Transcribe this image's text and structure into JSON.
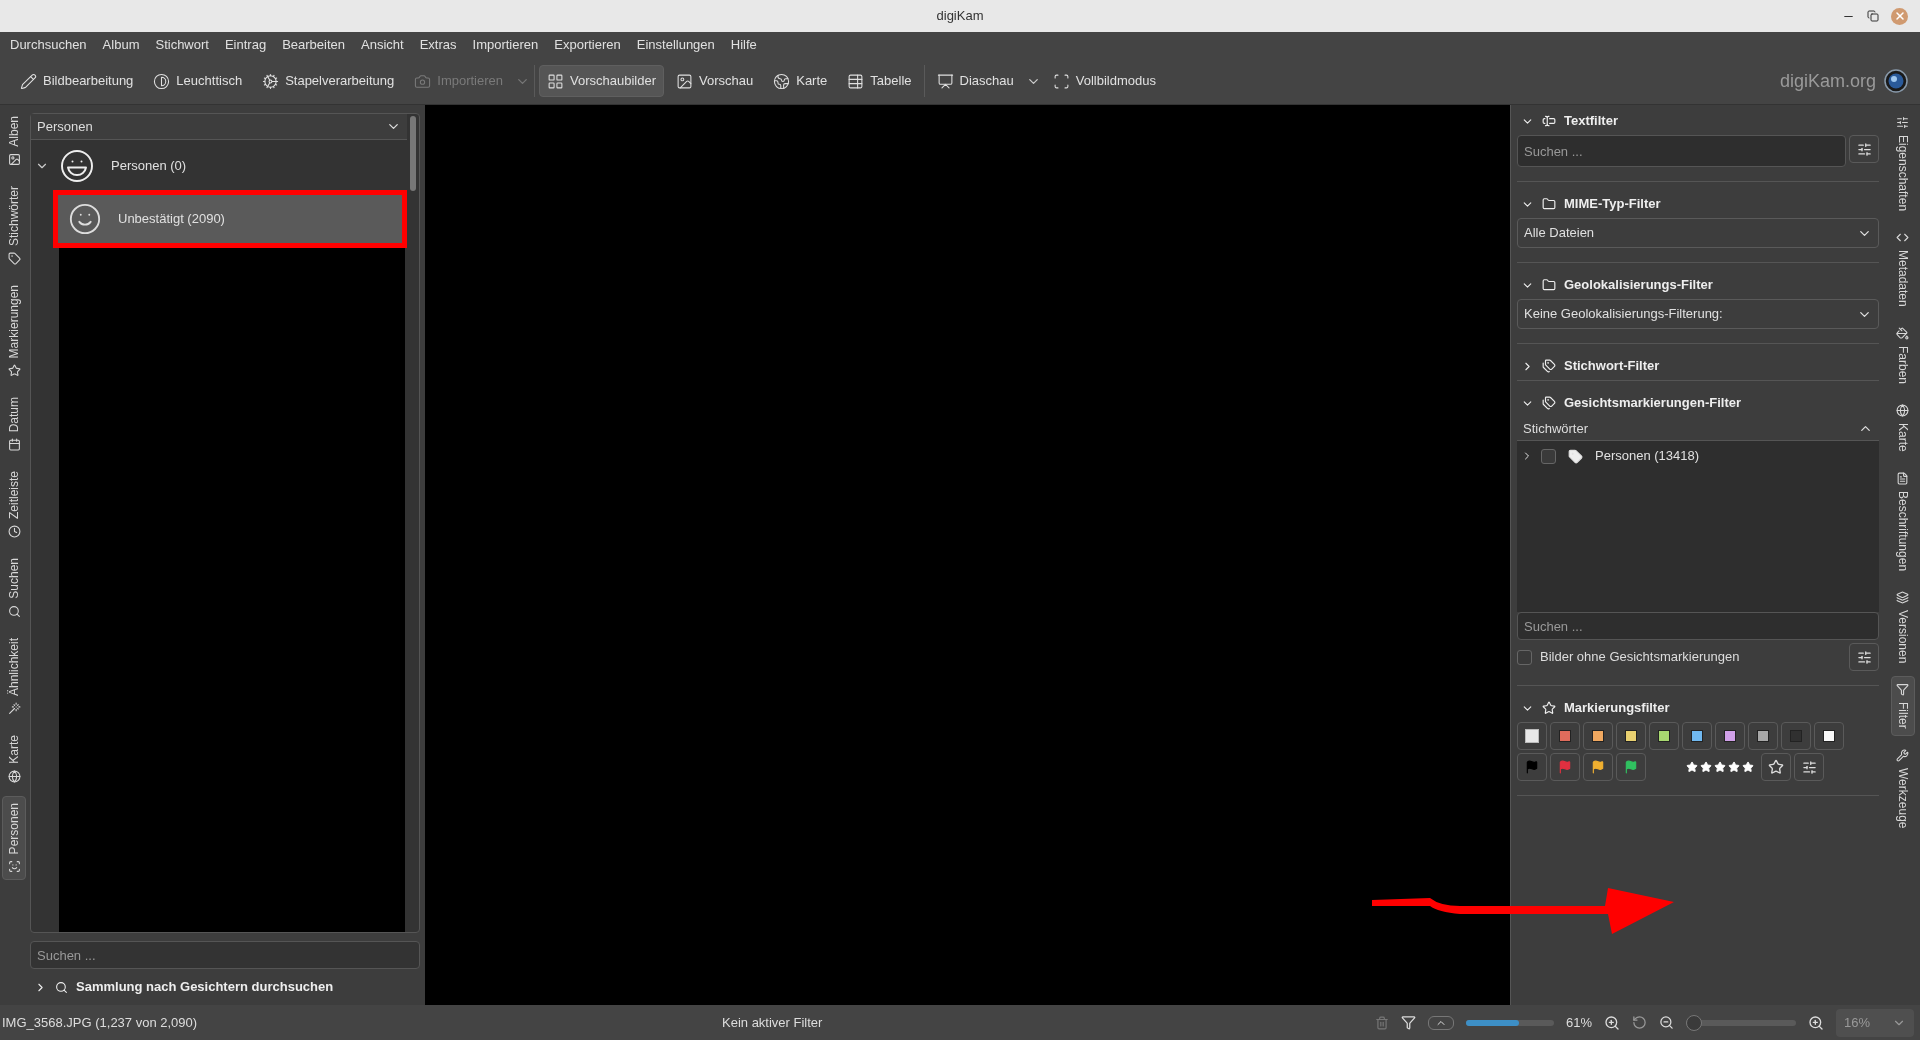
{
  "window": {
    "title": "digiKam"
  },
  "menu": [
    "Durchsuchen",
    "Album",
    "Stichwort",
    "Eintrag",
    "Bearbeiten",
    "Ansicht",
    "Extras",
    "Importieren",
    "Exportieren",
    "Einstellungen",
    "Hilfe"
  ],
  "toolbar": {
    "groups": [
      [
        {
          "label": "Bildbearbeitung",
          "has_menu": false,
          "disabled": false,
          "selected": false
        },
        {
          "label": "Leuchttisch",
          "has_menu": false,
          "disabled": false,
          "selected": false
        },
        {
          "label": "Stapelverarbeitung",
          "has_menu": false,
          "disabled": false,
          "selected": false
        },
        {
          "label": "Importieren",
          "has_menu": true,
          "disabled": true,
          "selected": false
        }
      ],
      [
        {
          "label": "Vorschaubilder",
          "has_menu": false,
          "disabled": false,
          "selected": true
        },
        {
          "label": "Vorschau",
          "has_menu": false,
          "disabled": false,
          "selected": false
        },
        {
          "label": "Karte",
          "has_menu": false,
          "disabled": false,
          "selected": false
        },
        {
          "label": "Tabelle",
          "has_menu": false,
          "disabled": false,
          "selected": false
        }
      ],
      [
        {
          "label": "Diaschau",
          "has_menu": true,
          "disabled": false,
          "selected": false
        },
        {
          "label": "Vollbildmodus",
          "has_menu": false,
          "disabled": false,
          "selected": false
        }
      ]
    ],
    "logo": "digiKam.org"
  },
  "left_tabs": [
    {
      "label": "Alben",
      "selected": false
    },
    {
      "label": "Stichwörter",
      "selected": false
    },
    {
      "label": "Markierungen",
      "selected": false
    },
    {
      "label": "Datum",
      "selected": false
    },
    {
      "label": "Zeitleiste",
      "selected": false
    },
    {
      "label": "Suchen",
      "selected": false
    },
    {
      "label": "Ähnlichkeit",
      "selected": false
    },
    {
      "label": "Karte",
      "selected": false
    },
    {
      "label": "Personen",
      "selected": true
    }
  ],
  "left_panel": {
    "header": "Personen",
    "tree": [
      {
        "label": "Personen (0)",
        "expanded": true,
        "selected": false,
        "highlighted": false,
        "children": [
          {
            "label": "Unbestätigt (2090)",
            "selected": true,
            "highlighted": true
          }
        ]
      }
    ],
    "search": {
      "placeholder": "Suchen ..."
    },
    "footer": {
      "label": "Sammlung nach Gesichtern durchsuchen",
      "expanded": false
    }
  },
  "right_panel": {
    "sections": [
      {
        "kind": "search",
        "title": "Textfilter",
        "expanded": true,
        "placeholder": "Suchen ..."
      },
      {
        "kind": "select",
        "title": "MIME-Typ-Filter",
        "expanded": true,
        "value": "Alle Dateien"
      },
      {
        "kind": "select",
        "title": "Geolokalisierungs-Filter",
        "expanded": true,
        "value": "Keine Geolokalisierungs-Filterung:"
      },
      {
        "kind": "tags",
        "title": "Stichwort-Filter",
        "expanded": false
      },
      {
        "kind": "faces",
        "title": "Gesichtsmarkierungen-Filter",
        "expanded": true,
        "tree_header": "Stichwörter",
        "tree": [
          {
            "label": "Personen (13418)",
            "checked": false,
            "expanded": false
          }
        ],
        "placeholder": "Suchen ...",
        "option": {
          "label": "Bilder ohne Gesichtsmarkierungen",
          "checked": false
        }
      },
      {
        "kind": "labels",
        "title": "Markierungsfilter",
        "expanded": true,
        "colors": [
          {
            "kind": "none"
          },
          {
            "kind": "color",
            "color": "#e06c5c"
          },
          {
            "kind": "color",
            "color": "#f0a860"
          },
          {
            "kind": "color",
            "color": "#e8d070"
          },
          {
            "kind": "color",
            "color": "#a8d870"
          },
          {
            "kind": "color",
            "color": "#70b8f0"
          },
          {
            "kind": "color",
            "color": "#d0a0e8"
          },
          {
            "kind": "color",
            "color": "#a8a8a8"
          },
          {
            "kind": "color",
            "color": "#303030"
          },
          {
            "kind": "color",
            "color": "#f8f8f8"
          }
        ],
        "flags": [
          {
            "color": "#000000"
          },
          {
            "color": "#e03040"
          },
          {
            "color": "#f0b030"
          },
          {
            "color": "#30c060"
          }
        ],
        "stars": 5
      }
    ]
  },
  "right_tabs": [
    {
      "label": "Eigenschaften",
      "selected": false
    },
    {
      "label": "Metadaten",
      "selected": false
    },
    {
      "label": "Farben",
      "selected": false
    },
    {
      "label": "Karte",
      "selected": false
    },
    {
      "label": "Beschriftungen",
      "selected": false
    },
    {
      "label": "Versionen",
      "selected": false
    },
    {
      "label": "Filter",
      "selected": true
    },
    {
      "label": "Werkzeuge",
      "selected": false
    }
  ],
  "status_bar": {
    "file": "IMG_3568.JPG (1,237 von 2,090)",
    "filter": "Kein aktiver Filter",
    "thumb_size": {
      "level": 0.6,
      "reading": "61%"
    },
    "zoom": {
      "level": 0,
      "value": "16%"
    }
  }
}
